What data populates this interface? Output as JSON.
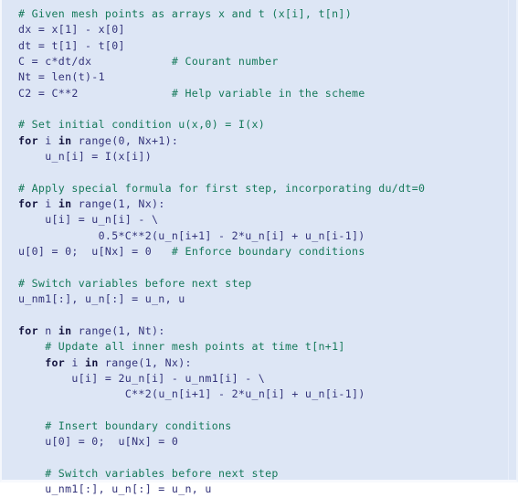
{
  "code_block": {
    "language": "python",
    "background_color": "#dde6f5",
    "colors": {
      "comment": "#15795a",
      "keyword": "#14143f",
      "code": "#33337a",
      "background": "#dde6f5",
      "border": "#f4f7fc"
    },
    "lines": [
      {
        "indent": "",
        "segments": [
          {
            "type": "comment",
            "text": "# Given mesh points as arrays x and t (x[i], t[n])"
          }
        ]
      },
      {
        "indent": "",
        "segments": [
          {
            "type": "code",
            "text": "dx = x[1] - x[0]"
          }
        ]
      },
      {
        "indent": "",
        "segments": [
          {
            "type": "code",
            "text": "dt = t[1] - t[0]"
          }
        ]
      },
      {
        "indent": "",
        "segments": [
          {
            "type": "code",
            "text": "C = c*dt/dx"
          },
          {
            "type": "code",
            "text": "            "
          },
          {
            "type": "comment",
            "text": "# Courant number"
          }
        ]
      },
      {
        "indent": "",
        "segments": [
          {
            "type": "code",
            "text": "Nt = len(t)-1"
          }
        ]
      },
      {
        "indent": "",
        "segments": [
          {
            "type": "code",
            "text": "C2 = C**2"
          },
          {
            "type": "code",
            "text": "              "
          },
          {
            "type": "comment",
            "text": "# Help variable in the scheme"
          }
        ]
      },
      {
        "indent": "",
        "segments": [
          {
            "type": "blank",
            "text": ""
          }
        ]
      },
      {
        "indent": "",
        "segments": [
          {
            "type": "comment",
            "text": "# Set initial condition u(x,0) = I(x)"
          }
        ]
      },
      {
        "indent": "",
        "segments": [
          {
            "type": "keyword",
            "text": "for"
          },
          {
            "type": "code",
            "text": " i "
          },
          {
            "type": "keyword",
            "text": "in"
          },
          {
            "type": "code",
            "text": " range(0, Nx+1):"
          }
        ]
      },
      {
        "indent": "    ",
        "segments": [
          {
            "type": "code",
            "text": "u_n[i] = I(x[i])"
          }
        ]
      },
      {
        "indent": "",
        "segments": [
          {
            "type": "blank",
            "text": ""
          }
        ]
      },
      {
        "indent": "",
        "segments": [
          {
            "type": "comment",
            "text": "# Apply special formula for first step, incorporating du/dt=0"
          }
        ]
      },
      {
        "indent": "",
        "segments": [
          {
            "type": "keyword",
            "text": "for"
          },
          {
            "type": "code",
            "text": " i "
          },
          {
            "type": "keyword",
            "text": "in"
          },
          {
            "type": "code",
            "text": " range(1, Nx):"
          }
        ]
      },
      {
        "indent": "    ",
        "segments": [
          {
            "type": "code",
            "text": "u[i] = u_n[i] - \\"
          }
        ]
      },
      {
        "indent": "            ",
        "segments": [
          {
            "type": "code",
            "text": "0.5*C**2(u_n[i+1] - 2*u_n[i] + u_n[i-1])"
          }
        ]
      },
      {
        "indent": "",
        "segments": [
          {
            "type": "code",
            "text": "u[0] = 0;  u[Nx] = 0"
          },
          {
            "type": "code",
            "text": "   "
          },
          {
            "type": "comment",
            "text": "# Enforce boundary conditions"
          }
        ]
      },
      {
        "indent": "",
        "segments": [
          {
            "type": "blank",
            "text": ""
          }
        ]
      },
      {
        "indent": "",
        "segments": [
          {
            "type": "comment",
            "text": "# Switch variables before next step"
          }
        ]
      },
      {
        "indent": "",
        "segments": [
          {
            "type": "code",
            "text": "u_nm1[:], u_n[:] = u_n, u"
          }
        ]
      },
      {
        "indent": "",
        "segments": [
          {
            "type": "blank",
            "text": ""
          }
        ]
      },
      {
        "indent": "",
        "segments": [
          {
            "type": "keyword",
            "text": "for"
          },
          {
            "type": "code",
            "text": " n "
          },
          {
            "type": "keyword",
            "text": "in"
          },
          {
            "type": "code",
            "text": " range(1, Nt):"
          }
        ]
      },
      {
        "indent": "    ",
        "segments": [
          {
            "type": "comment",
            "text": "# Update all inner mesh points at time t[n+1]"
          }
        ]
      },
      {
        "indent": "    ",
        "segments": [
          {
            "type": "keyword",
            "text": "for"
          },
          {
            "type": "code",
            "text": " i "
          },
          {
            "type": "keyword",
            "text": "in"
          },
          {
            "type": "code",
            "text": " range(1, Nx):"
          }
        ]
      },
      {
        "indent": "        ",
        "segments": [
          {
            "type": "code",
            "text": "u[i] = 2u_n[i] - u_nm1[i] - \\"
          }
        ]
      },
      {
        "indent": "                ",
        "segments": [
          {
            "type": "code",
            "text": "C**2(u_n[i+1] - 2*u_n[i] + u_n[i-1])"
          }
        ]
      },
      {
        "indent": "",
        "segments": [
          {
            "type": "blank",
            "text": ""
          }
        ]
      },
      {
        "indent": "    ",
        "segments": [
          {
            "type": "comment",
            "text": "# Insert boundary conditions"
          }
        ]
      },
      {
        "indent": "    ",
        "segments": [
          {
            "type": "code",
            "text": "u[0] = 0;  u[Nx] = 0"
          }
        ]
      },
      {
        "indent": "",
        "segments": [
          {
            "type": "blank",
            "text": ""
          }
        ]
      },
      {
        "indent": "    ",
        "segments": [
          {
            "type": "comment",
            "text": "# Switch variables before next step"
          }
        ]
      },
      {
        "indent": "    ",
        "segments": [
          {
            "type": "code",
            "text": "u_nm1[:], u_n[:] = u_n, u"
          }
        ]
      }
    ]
  }
}
